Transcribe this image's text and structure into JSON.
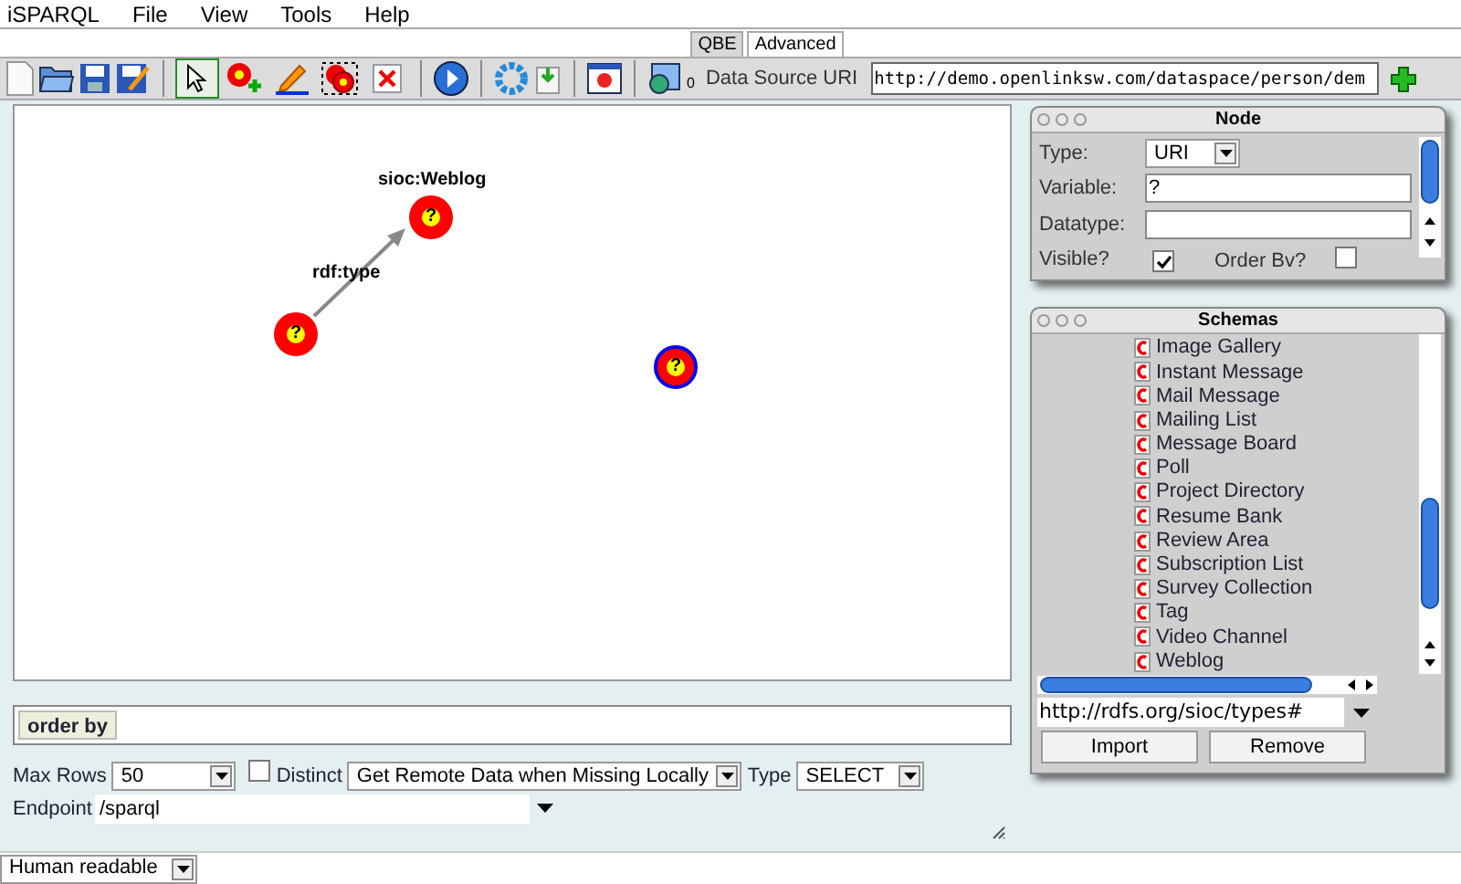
{
  "menu_bar": {
    "items": [
      "iSPARQL",
      "File",
      "View",
      "Tools",
      "Help"
    ]
  },
  "tabs": [
    {
      "label": "QBE",
      "selected": true
    },
    {
      "label": "Advanced",
      "selected": false
    }
  ],
  "toolbar": {
    "tools": [
      {
        "kind": "pointer",
        "selected": true
      },
      {
        "kind": "add-node",
        "selected": false
      },
      {
        "kind": "edit",
        "selected": false
      },
      {
        "kind": "group",
        "selected": false
      },
      {
        "kind": "delete",
        "selected": false
      }
    ],
    "data_source_count": "0",
    "data_source_label": "Data Source URI",
    "data_source_value": "http://demo.openlinksw.com/dataspace/person/dem"
  },
  "graph": {
    "nodes": [
      {
        "label": "?",
        "selected": false
      },
      {
        "label": "?",
        "caption": "sioc:Weblog",
        "selected": false
      },
      {
        "label": "?",
        "selected": true
      }
    ],
    "edges": [
      {
        "label": "rdf:type"
      }
    ]
  },
  "order_by": {
    "label": "order by"
  },
  "options": {
    "max_rows_label": "Max Rows",
    "max_rows": "50",
    "distinct_label": "Distinct",
    "distinct_checked": false,
    "remote_data": "Get Remote Data when Missing Locally",
    "type_label": "Type",
    "type": "SELECT",
    "endpoint_label": "Endpoint",
    "endpoint": "/sparql"
  },
  "output_format": "Human readable",
  "node_panel": {
    "title": "Node",
    "type_label": "Type:",
    "type": "URI",
    "variable_label": "Variable:",
    "variable": "?",
    "datatype_label": "Datatype:",
    "visible_label": "Visible?",
    "visible": true,
    "order_by_label": "Order Bv?",
    "order_by": false
  },
  "schemas_panel": {
    "title": "Schemas",
    "items": [
      "Image Gallery",
      "Instant Message",
      "Mail Message",
      "Mailing List",
      "Message Board",
      "Poll",
      "Project Directory",
      "Resume Bank",
      "Review Area",
      "Subscription List",
      "Survey Collection",
      "Tag",
      "Video Channel",
      "Weblog"
    ],
    "schema_uri": "http://rdfs.org/sioc/types#",
    "buttons": [
      "Import",
      "Remove"
    ]
  }
}
